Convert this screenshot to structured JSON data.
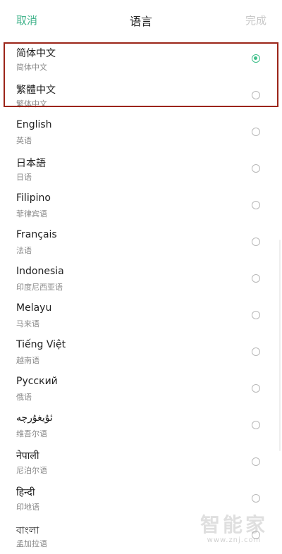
{
  "header": {
    "cancel": "取消",
    "title": "语言",
    "done": "完成"
  },
  "colors": {
    "accent": "#3fbf8a",
    "highlight_border": "#9b2418"
  },
  "languages": [
    {
      "name": "简体中文",
      "native": "简体中文",
      "selected": true
    },
    {
      "name": "繁體中文",
      "native": "繁体中文",
      "selected": false
    },
    {
      "name": "English",
      "native": "英语",
      "selected": false
    },
    {
      "name": "日本語",
      "native": "日语",
      "selected": false
    },
    {
      "name": "Filipino",
      "native": "菲律宾语",
      "selected": false
    },
    {
      "name": "Français",
      "native": "法语",
      "selected": false
    },
    {
      "name": "Indonesia",
      "native": "印度尼西亚语",
      "selected": false
    },
    {
      "name": "Melayu",
      "native": "马来语",
      "selected": false
    },
    {
      "name": "Tiếng Việt",
      "native": "越南语",
      "selected": false
    },
    {
      "name": "Русский",
      "native": "俄语",
      "selected": false
    },
    {
      "name": "ئۇيغۇرچە",
      "native": "维吾尔语",
      "selected": false
    },
    {
      "name": "नेपाली",
      "native": "尼泊尔语",
      "selected": false
    },
    {
      "name": "हिन्दी",
      "native": "印地语",
      "selected": false
    },
    {
      "name": "বাংলা",
      "native": "孟加拉语",
      "selected": false
    }
  ],
  "watermark": {
    "text": "智能家",
    "url": "www.znj.com"
  }
}
